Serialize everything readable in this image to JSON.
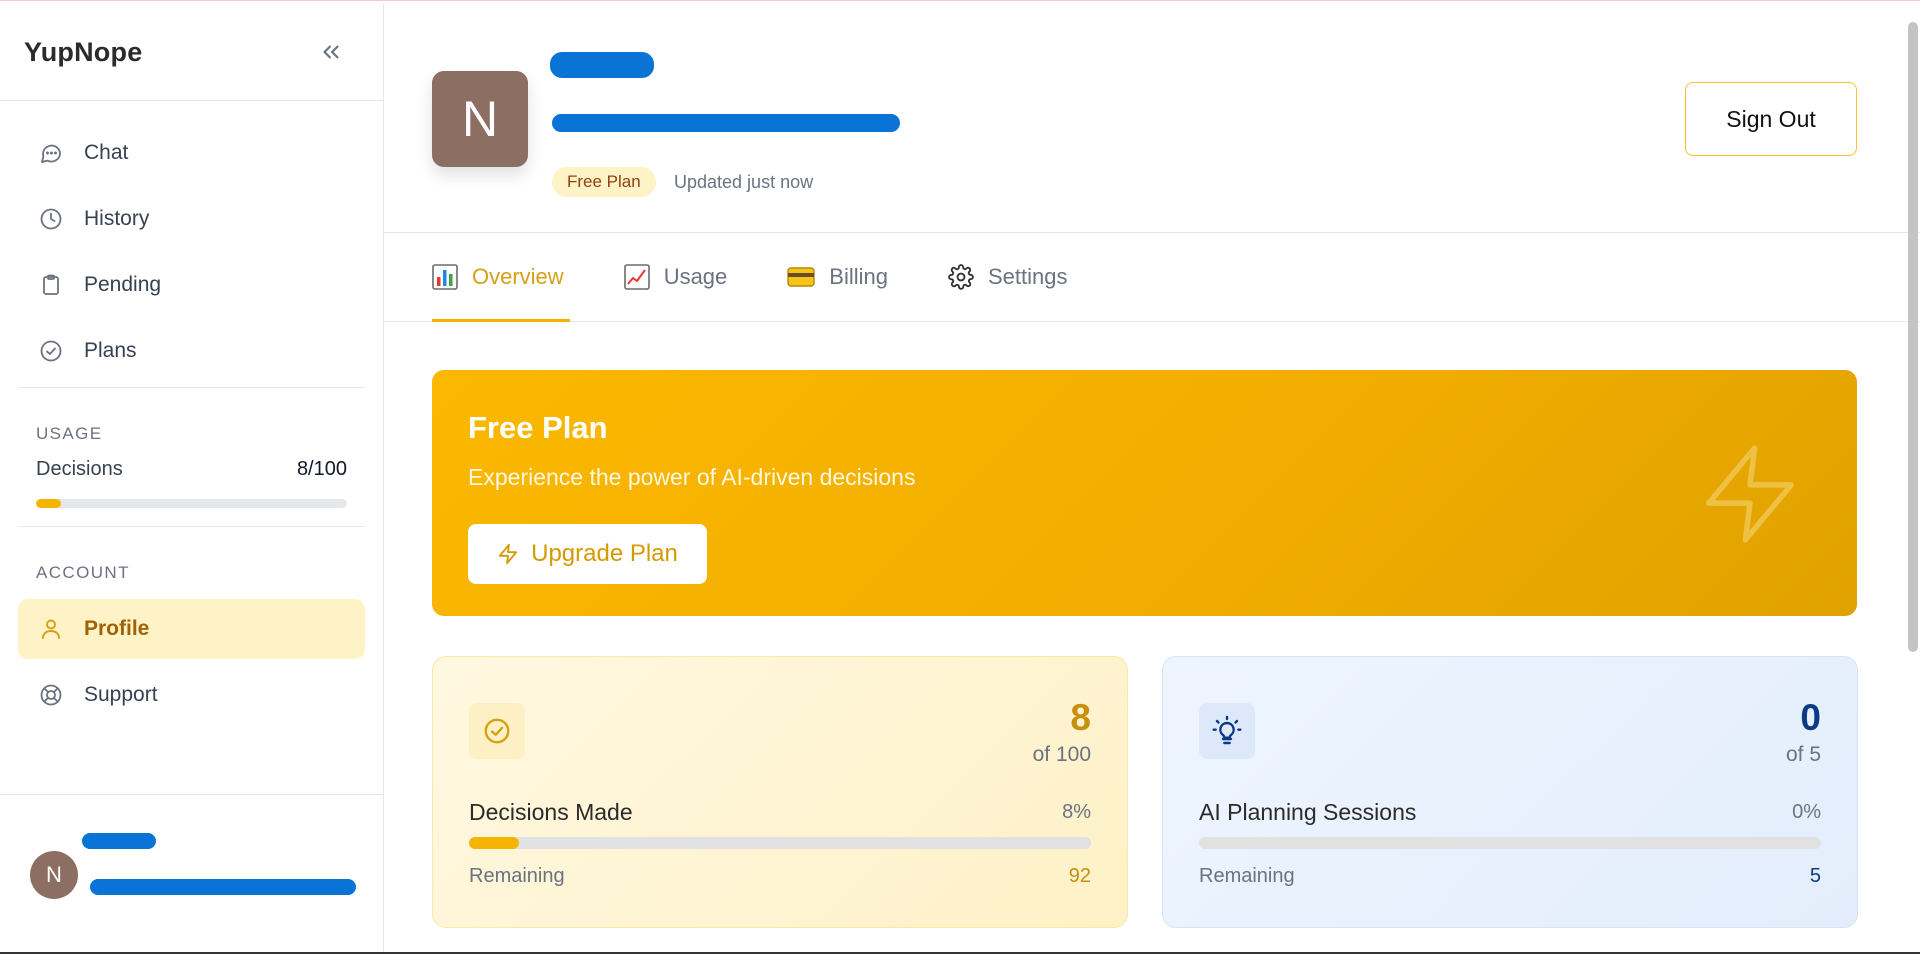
{
  "sidebar": {
    "brand": "YupNope",
    "nav": [
      {
        "label": "Chat",
        "icon": "chat-bubble-icon"
      },
      {
        "label": "History",
        "icon": "clock-icon"
      },
      {
        "label": "Pending",
        "icon": "clipboard-icon"
      },
      {
        "label": "Plans",
        "icon": "check-circle-icon"
      }
    ],
    "usage": {
      "title": "USAGE",
      "label": "Decisions",
      "value": "8/100",
      "progress": 0.08
    },
    "account": {
      "title": "ACCOUNT",
      "items": [
        {
          "label": "Profile",
          "icon": "user-icon",
          "active": true
        },
        {
          "label": "Support",
          "icon": "lifebuoy-icon",
          "active": false
        }
      ]
    },
    "footer": {
      "avatar_initial": "N"
    }
  },
  "header": {
    "avatar_initial": "N",
    "plan_badge": "Free Plan",
    "updated": "Updated just now",
    "signout_label": "Sign Out"
  },
  "tabs": [
    {
      "label": "Overview",
      "icon": "bar-chart-icon",
      "active": true
    },
    {
      "label": "Usage",
      "icon": "line-chart-icon",
      "active": false
    },
    {
      "label": "Billing",
      "icon": "credit-card-icon",
      "active": false
    },
    {
      "label": "Settings",
      "icon": "gear-icon",
      "active": false
    }
  ],
  "banner": {
    "title": "Free Plan",
    "subtitle": "Experience the power of AI-driven decisions",
    "button_label": "Upgrade Plan"
  },
  "cards": [
    {
      "label": "Decisions Made",
      "value": "8",
      "of": "of 100",
      "percent": "8%",
      "progress": 0.08,
      "remaining_label": "Remaining",
      "remaining": "92"
    },
    {
      "label": "AI Planning Sessions",
      "value": "0",
      "of": "of 5",
      "percent": "0%",
      "progress": 0,
      "remaining_label": "Remaining",
      "remaining": "5"
    }
  ],
  "colors": {
    "accent": "#f4b400",
    "accent_text": "#d4a017",
    "avatar": "#8d6e63",
    "blue_stat": "#0b3a86",
    "redaction": "#0a73d6"
  }
}
